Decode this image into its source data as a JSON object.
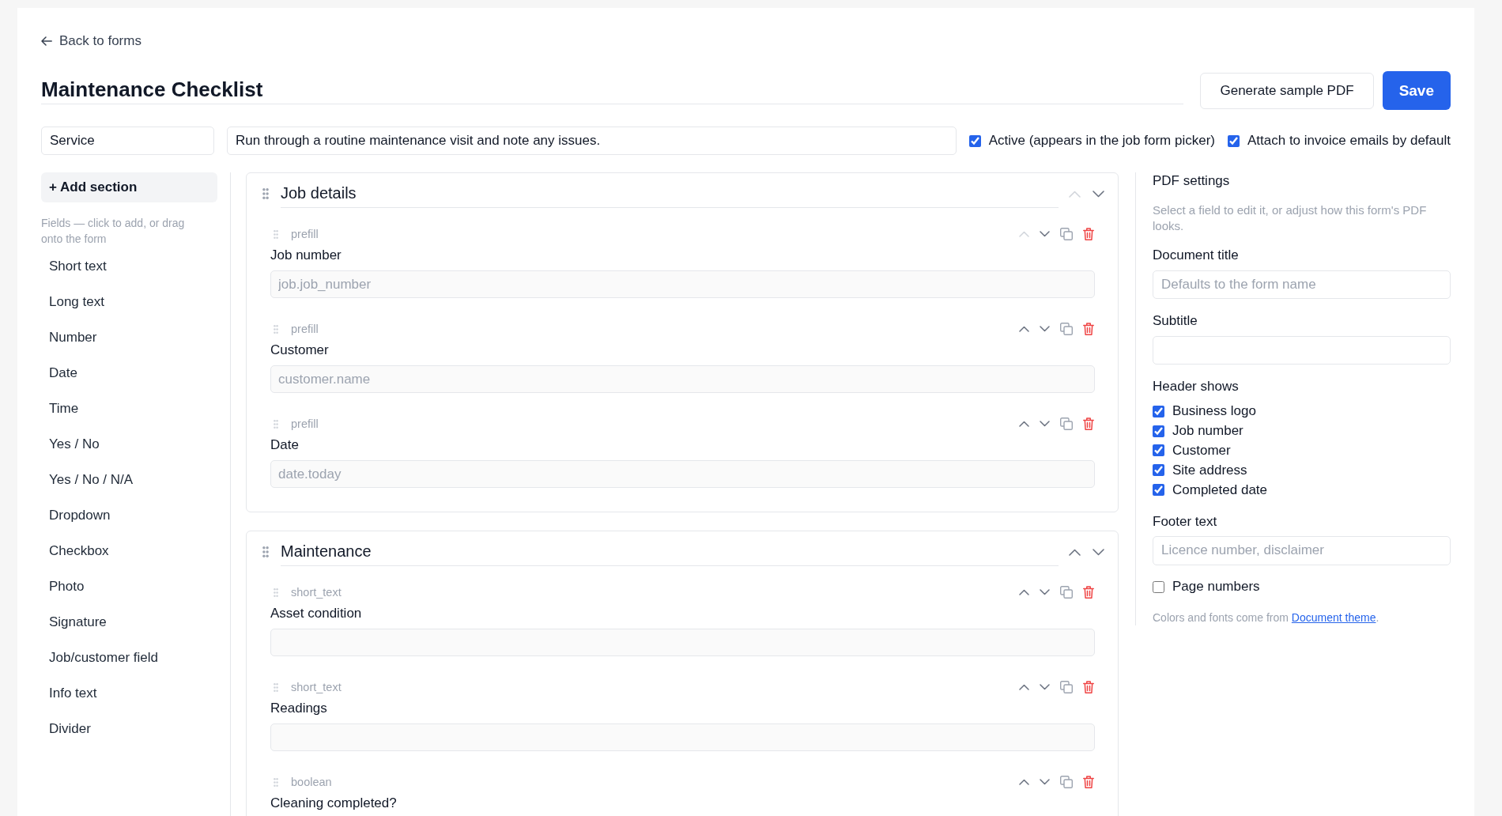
{
  "back_link": {
    "label": "Back to forms"
  },
  "form": {
    "name": "Maintenance Checklist",
    "category": "Service",
    "description": "Run through a routine maintenance visit and note any issues.",
    "options": [
      {
        "label": "Active (appears in the job form picker)",
        "checked": true
      },
      {
        "label": "Attach to invoice emails by default",
        "checked": true
      }
    ]
  },
  "header_buttons": [
    {
      "label": "Generate sample PDF",
      "kind": "secondary"
    },
    {
      "label": "Save",
      "kind": "primary"
    }
  ],
  "palette": {
    "add_section": "+ Add section",
    "hint": "Fields — click to add, or drag onto the form",
    "items": [
      "Short text",
      "Long text",
      "Number",
      "Date",
      "Time",
      "Yes / No",
      "Yes / No / N/A",
      "Dropdown",
      "Checkbox",
      "Photo",
      "Signature",
      "Job/customer field",
      "Info text",
      "Divider"
    ]
  },
  "sections": [
    {
      "title": "Job details",
      "move_up_disabled": true,
      "fields": [
        {
          "type": "prefill",
          "label": "Job number",
          "kind": "text",
          "placeholder": "job.job_number",
          "move_up_disabled": true
        },
        {
          "type": "prefill",
          "label": "Customer",
          "kind": "text",
          "placeholder": "customer.name",
          "move_up_disabled": false
        },
        {
          "type": "prefill",
          "label": "Date",
          "kind": "text",
          "placeholder": "date.today",
          "move_up_disabled": false
        }
      ]
    },
    {
      "title": "Maintenance",
      "move_up_disabled": false,
      "fields": [
        {
          "type": "short_text",
          "label": "Asset condition",
          "kind": "text",
          "move_up_disabled": false
        },
        {
          "type": "short_text",
          "label": "Readings",
          "kind": "text",
          "move_up_disabled": false
        },
        {
          "type": "boolean",
          "label": "Cleaning completed?",
          "kind": "boolean",
          "move_up_disabled": false
        }
      ]
    }
  ],
  "pdf_settings": {
    "title": "PDF settings",
    "hint": "Select a field to edit it, or adjust how this form's PDF looks.",
    "document_title": {
      "label": "Document title",
      "placeholder": "Defaults to the form name"
    },
    "subtitle": {
      "label": "Subtitle"
    },
    "header_shows": {
      "label": "Header shows",
      "items": [
        {
          "label": "Business logo",
          "checked": true
        },
        {
          "label": "Job number",
          "checked": true
        },
        {
          "label": "Customer",
          "checked": true
        },
        {
          "label": "Site address",
          "checked": true
        },
        {
          "label": "Completed date",
          "checked": true
        }
      ]
    },
    "footer_text": {
      "label": "Footer text",
      "placeholder": "Licence number, disclaimer"
    },
    "page_numbers": {
      "label": "Page numbers",
      "checked": false
    },
    "note": {
      "before": "Colors and fonts come from ",
      "link": "Document theme",
      "after": "."
    }
  }
}
